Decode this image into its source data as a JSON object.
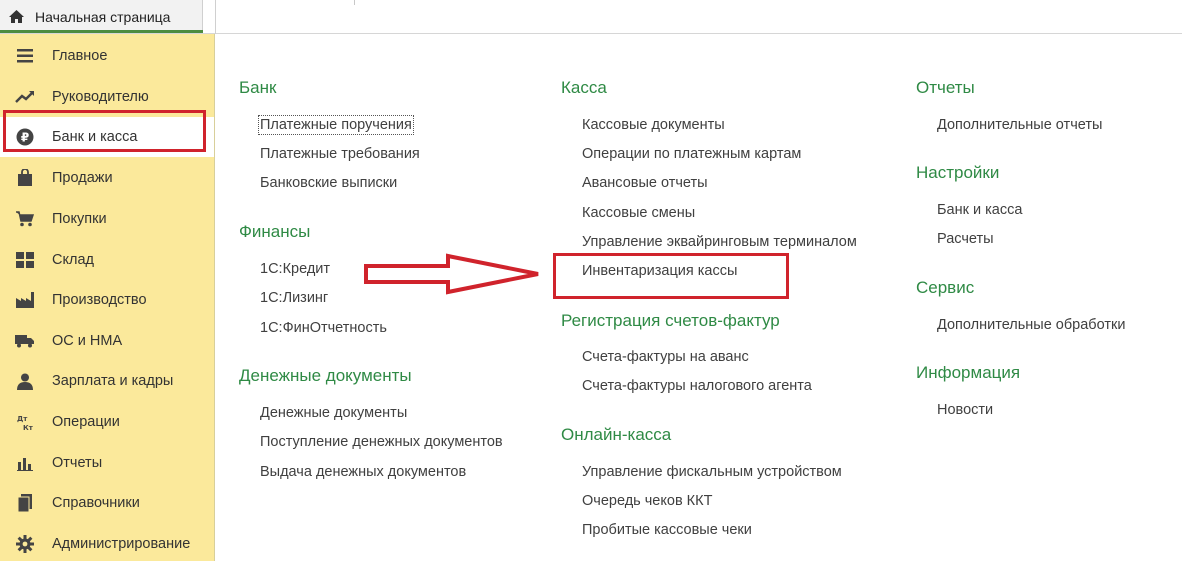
{
  "tab": {
    "home_label": "Начальная страница"
  },
  "sidebar": {
    "items": [
      {
        "label": "Главное",
        "icon": "menu-lines-icon"
      },
      {
        "label": "Руководителю",
        "icon": "trend-up-icon"
      },
      {
        "label": "Банк и касса",
        "icon": "ruble-coin-icon"
      },
      {
        "label": "Продажи",
        "icon": "shopping-bag-icon"
      },
      {
        "label": "Покупки",
        "icon": "cart-icon"
      },
      {
        "label": "Склад",
        "icon": "warehouse-grid-icon"
      },
      {
        "label": "Производство",
        "icon": "factory-icon"
      },
      {
        "label": "ОС и НМА",
        "icon": "truck-icon"
      },
      {
        "label": "Зарплата и кадры",
        "icon": "person-icon"
      },
      {
        "label": "Операции",
        "icon": "debit-credit-icon"
      },
      {
        "label": "Отчеты",
        "icon": "bar-chart-icon"
      },
      {
        "label": "Справочники",
        "icon": "books-icon"
      },
      {
        "label": "Администрирование",
        "icon": "gear-icon"
      }
    ],
    "active_index": 2
  },
  "sections": {
    "bank": {
      "title": "Банк",
      "links": [
        "Платежные поручения",
        "Платежные требования",
        "Банковские выписки"
      ]
    },
    "finance": {
      "title": "Финансы",
      "links": [
        "1С:Кредит",
        "1С:Лизинг",
        "1С:ФинОтчетность"
      ]
    },
    "money_docs": {
      "title": "Денежные документы",
      "links": [
        "Денежные документы",
        "Поступление денежных документов",
        "Выдача денежных документов"
      ]
    },
    "cash": {
      "title": "Касса",
      "links": [
        "Кассовые документы",
        "Операции по платежным картам",
        "Авансовые отчеты",
        "Кассовые смены",
        "Управление эквайринговым терминалом",
        "Инвентаризация кассы"
      ]
    },
    "invoices": {
      "title": "Регистрация счетов-фактур",
      "links": [
        "Счета-фактуры на аванс",
        "Счета-фактуры налогового агента"
      ]
    },
    "online_cash": {
      "title": "Онлайн-касса",
      "links": [
        "Управление фискальным устройством",
        "Очередь чеков ККТ",
        "Пробитые кассовые чеки"
      ]
    },
    "reports": {
      "title": "Отчеты",
      "links": [
        "Дополнительные отчеты"
      ]
    },
    "settings": {
      "title": "Настройки",
      "links": [
        "Банк и касса",
        "Расчеты"
      ]
    },
    "service": {
      "title": "Сервис",
      "links": [
        "Дополнительные обработки"
      ]
    },
    "info": {
      "title": "Информация",
      "links": [
        "Новости"
      ]
    }
  },
  "colors": {
    "sidebar_bg": "#fbe99b",
    "section_title": "#2f8a45",
    "annotation_red": "#d0232c",
    "tab_accent": "#4c8c3f"
  }
}
